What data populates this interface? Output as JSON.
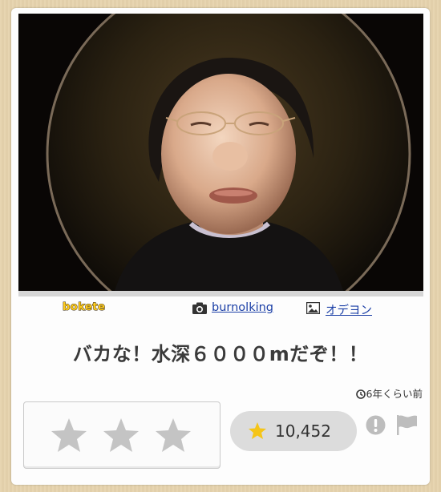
{
  "brand": {
    "logo_text": "bokete"
  },
  "post": {
    "photo_alt": "fisheye portrait photo",
    "photographer": "burnolking",
    "photo_source": "オデヨン",
    "caption": "バカな！水深６０００mだぞ！！",
    "time_ago": "6年くらい前",
    "star_count": "10,452"
  },
  "rating": {
    "stars": 3
  },
  "icons": {
    "photographer": "camera-icon",
    "source": "image-icon",
    "time": "clock-icon",
    "rate": "star-icon",
    "report": "warning-icon",
    "flag": "flag-icon"
  },
  "colors": {
    "link": "#1b3fa6",
    "star_gold": "#f5c518",
    "star_gray": "#c4c4c4",
    "background": "#e6d3ad"
  }
}
